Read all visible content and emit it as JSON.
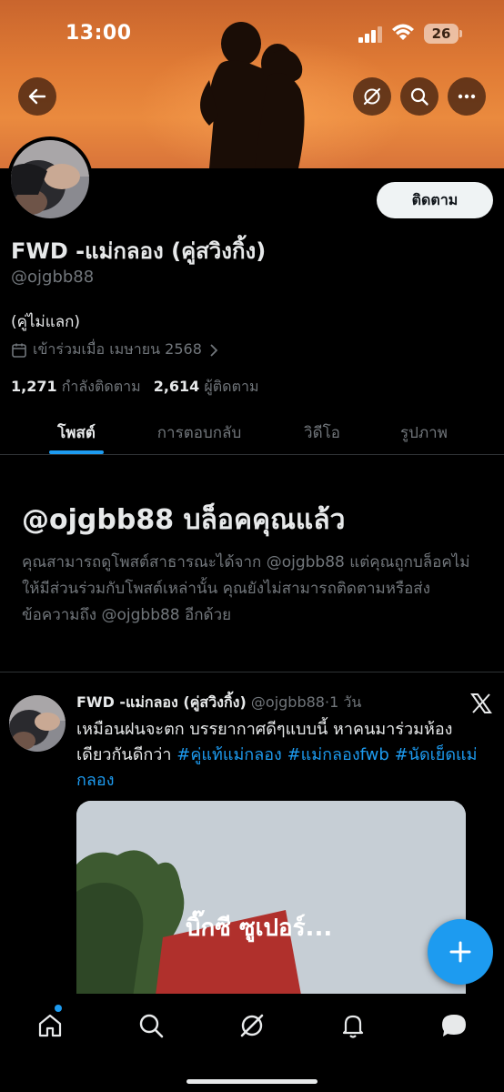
{
  "status_bar": {
    "time": "13:00",
    "battery": "26"
  },
  "profile": {
    "display_name": "FWD -แม่กลอง (คู่สวิงกิ้ง)",
    "handle": "@ojgbb88",
    "bio": "(คู่ไม่แลก)",
    "joined": "เข้าร่วมเมื่อ เมษายน 2568",
    "following_count": "1,271",
    "following_label": "กำลังติดตาม",
    "followers_count": "2,614",
    "followers_label": "ผู้ติดตาม",
    "follow_button": "ติดตาม"
  },
  "tabs": [
    {
      "label": "โพสต์",
      "active": true
    },
    {
      "label": "การตอบกลับ",
      "active": false
    },
    {
      "label": "วิดีโอ",
      "active": false
    },
    {
      "label": "รูปภาพ",
      "active": false
    }
  ],
  "blocked": {
    "title": "@ojgbb88 บล็อคคุณแล้ว",
    "text": "คุณสามารถดูโพสต์สาธารณะได้จาก @ojgbb88 แต่คุณถูกบล็อคไม่ให้มีส่วนร่วมกับโพสต์เหล่านั้น คุณยังไม่สามารถติดตามหรือส่งข้อความถึง @ojgbb88 อีกด้วย"
  },
  "tweet": {
    "name": "FWD -แม่กลอง (คู่สวิงกิ้ง)",
    "handle": "@ojgbb88",
    "separator": "·",
    "time": "1 วัน",
    "text": "เหมือนฝนจะตก บรรยากาศดีๆแบบนี้ หาคนมาร่วมห้อง เดียวกันดีกว่า",
    "hashtags": [
      "#คู่แท้แม่กลอง",
      "#แม่กลองfwb",
      "#นัดเย็ดแม่กลอง"
    ],
    "media_sign_text": "บิ๊กซี ซูเปอร์..."
  },
  "colors": {
    "accent": "#1d9bf0",
    "background": "#000000",
    "muted": "#71767b",
    "text": "#e7e9ea"
  },
  "icons": {
    "back": "arrow-left-icon",
    "grok": "grok-icon",
    "search": "search-icon",
    "more": "more-icon",
    "calendar": "calendar-icon",
    "chevron": "chevron-right-icon",
    "x_logo": "x-logo-icon",
    "compose": "plus-icon",
    "nav": [
      "home-icon",
      "search-icon",
      "grok-icon",
      "bell-icon",
      "messages-icon"
    ]
  }
}
